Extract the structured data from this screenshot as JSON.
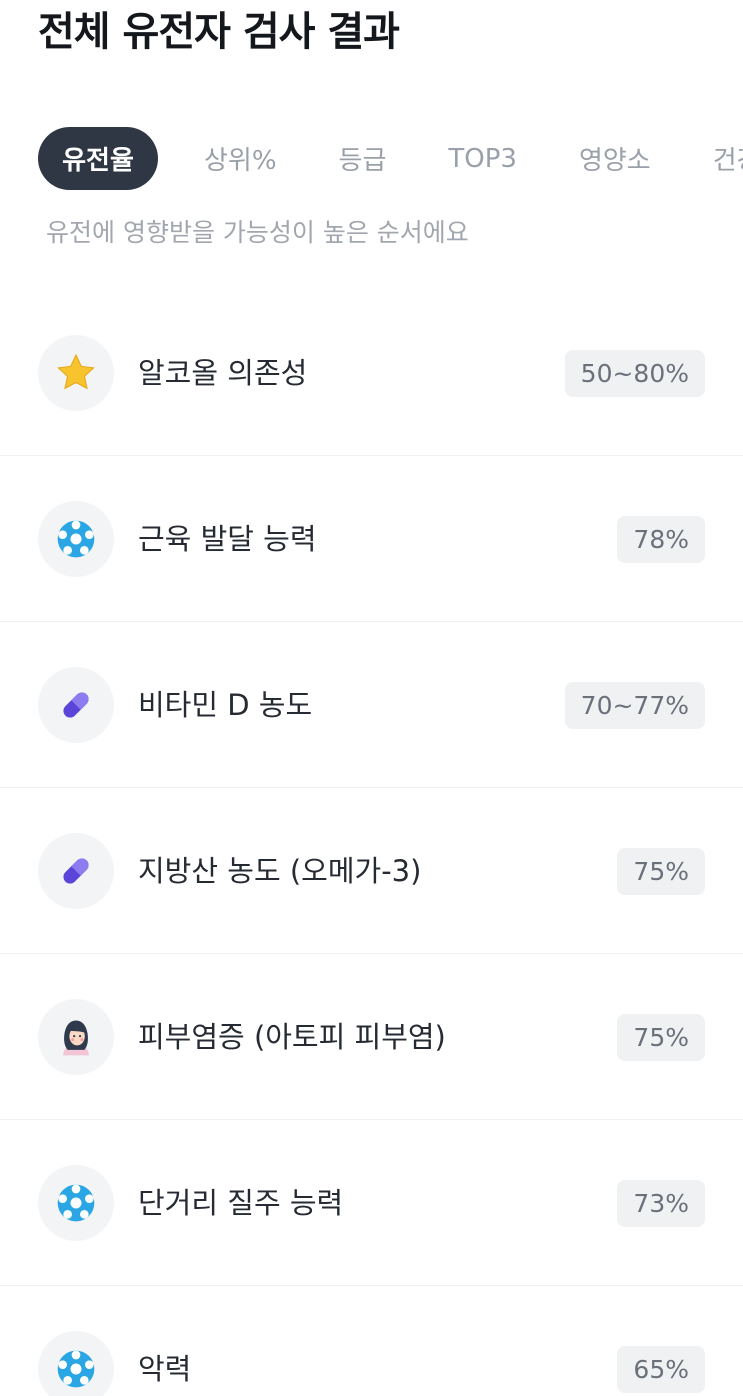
{
  "header": {
    "title": "전체 유전자 검사 결과"
  },
  "tabs": [
    {
      "label": "유전율"
    },
    {
      "label": "상위%"
    },
    {
      "label": "등급"
    },
    {
      "label": "TOP3"
    },
    {
      "label": "영양소"
    },
    {
      "label": "건강"
    }
  ],
  "subtitle": "유전에 영향받을 가능성이 높은 순서에요",
  "items": [
    {
      "label": "알코올 의존성",
      "value": "50~80%",
      "icon": "star-icon"
    },
    {
      "label": "근육 발달 능력",
      "value": "78%",
      "icon": "soccer-ball-icon"
    },
    {
      "label": "비타민 D 농도",
      "value": "70~77%",
      "icon": "pill-icon"
    },
    {
      "label": "지방산 농도 (오메가-3)",
      "value": "75%",
      "icon": "pill-icon"
    },
    {
      "label": "피부염증 (아토피 피부염)",
      "value": "75%",
      "icon": "woman-face-icon"
    },
    {
      "label": "단거리 질주 능력",
      "value": "73%",
      "icon": "soccer-ball-icon"
    },
    {
      "label": "악력",
      "value": "65%",
      "icon": "soccer-ball-icon"
    }
  ],
  "colors": {
    "active_tab_bg": "#2f3644",
    "star": "#f7c42d",
    "ball": "#29a6e3",
    "pill": "#6b52e6"
  }
}
